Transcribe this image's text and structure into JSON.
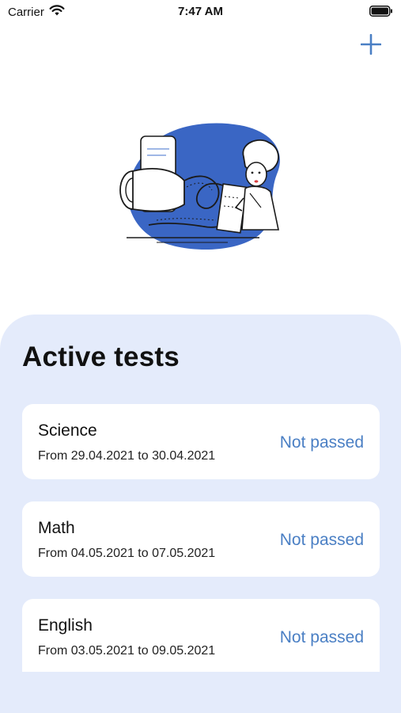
{
  "status_bar": {
    "carrier": "Carrier",
    "time": "7:47 AM",
    "wifi_icon": "wifi-icon",
    "battery_icon": "battery-icon"
  },
  "toolbar": {
    "add_icon": "plus-icon"
  },
  "illustration": {
    "name": "scientist-with-tests-illustration",
    "blob_color": "#3a66c4"
  },
  "panel": {
    "title": "Active tests",
    "background": "#e4ebfb"
  },
  "tests": [
    {
      "name": "Science",
      "dates": "From 29.04.2021 to 30.04.2021",
      "status": "Not passed"
    },
    {
      "name": "Math",
      "dates": "From 04.05.2021 to 07.05.2021",
      "status": "Not passed"
    },
    {
      "name": "English",
      "dates": "From 03.05.2021 to 09.05.2021",
      "status": "Not passed"
    }
  ],
  "colors": {
    "accent": "#4a7fc4",
    "card": "#ffffff"
  }
}
